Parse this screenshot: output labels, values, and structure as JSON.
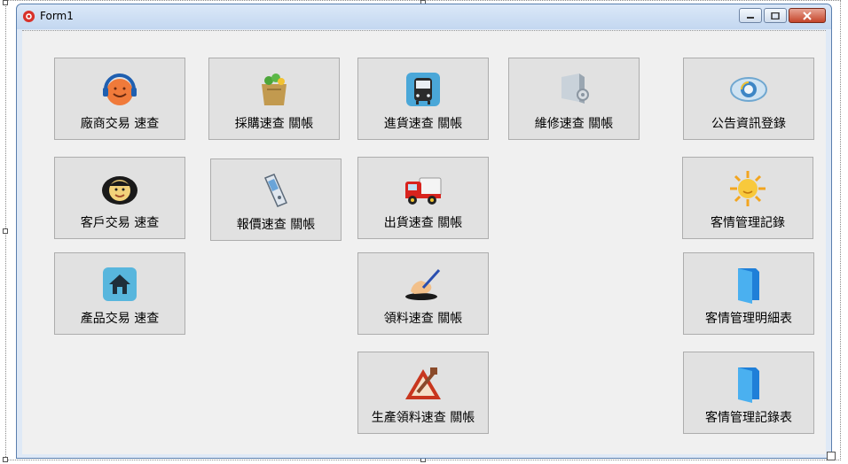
{
  "window": {
    "title": "Form1"
  },
  "buttons": {
    "vendor": "廠商交易 速查",
    "purchase": "採購速查 關帳",
    "incoming": "進貨速查 關帳",
    "repair": "維修速查 關帳",
    "announce": "公告資訊登錄",
    "customer": "客戶交易 速查",
    "quote": "報價速查 關帳",
    "shipping": "出貨速查 關帳",
    "crm_record": "客情管理記錄",
    "product": "產品交易 速查",
    "material": "領料速查  關帳",
    "crm_detail": "客情管理明細表",
    "production": "生產領料速查 關帳",
    "crm_log": "客情管理記錄表"
  },
  "icons": {
    "vendor": "headphones-face-icon",
    "purchase": "shopping-bag-icon",
    "incoming": "bus-icon",
    "repair": "monitor-gear-icon",
    "announce": "eye-icon",
    "customer": "face-icon",
    "quote": "phone-icon",
    "shipping": "truck-icon",
    "crm_record": "sun-icon",
    "product": "home-icon",
    "material": "writing-hand-icon",
    "crm_detail": "folder-icon",
    "production": "warning-tools-icon",
    "crm_log": "folder-icon"
  },
  "colors": {
    "title_bg": "#c3d7f0",
    "client_bg": "#f0f0f0",
    "button_bg": "#e1e1e1",
    "close_btn": "#c5452b"
  }
}
